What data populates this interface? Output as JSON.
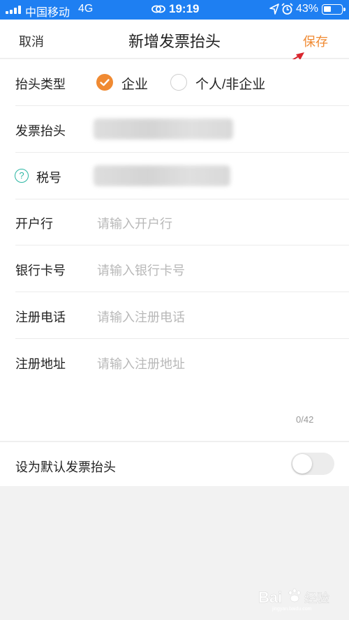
{
  "status_bar": {
    "carrier": "中国移动",
    "network": "4G",
    "time": "19:19",
    "battery_percent": "43%",
    "battery_level": 0.43,
    "bar_color": "#1e7ff2"
  },
  "nav": {
    "cancel_label": "取消",
    "title": "新增发票抬头",
    "save_label": "保存",
    "accent_color": "#f08a32"
  },
  "form": {
    "type_label": "抬头类型",
    "type_options": [
      {
        "label": "企业",
        "selected": true
      },
      {
        "label": "个人/非企业",
        "selected": false
      }
    ],
    "header_label": "发票抬头",
    "tax_label": "税号",
    "bank_label": "开户行",
    "bank_placeholder": "请输入开户行",
    "card_label": "银行卡号",
    "card_placeholder": "请输入银行卡号",
    "phone_label": "注册电话",
    "phone_placeholder": "请输入注册电话",
    "address_label": "注册地址",
    "address_placeholder": "请输入注册地址",
    "address_counter": "0/42"
  },
  "default_setting": {
    "label": "设为默认发票抬头",
    "enabled": false
  },
  "icons": {
    "help": "question-circle-icon",
    "check": "check-icon"
  }
}
